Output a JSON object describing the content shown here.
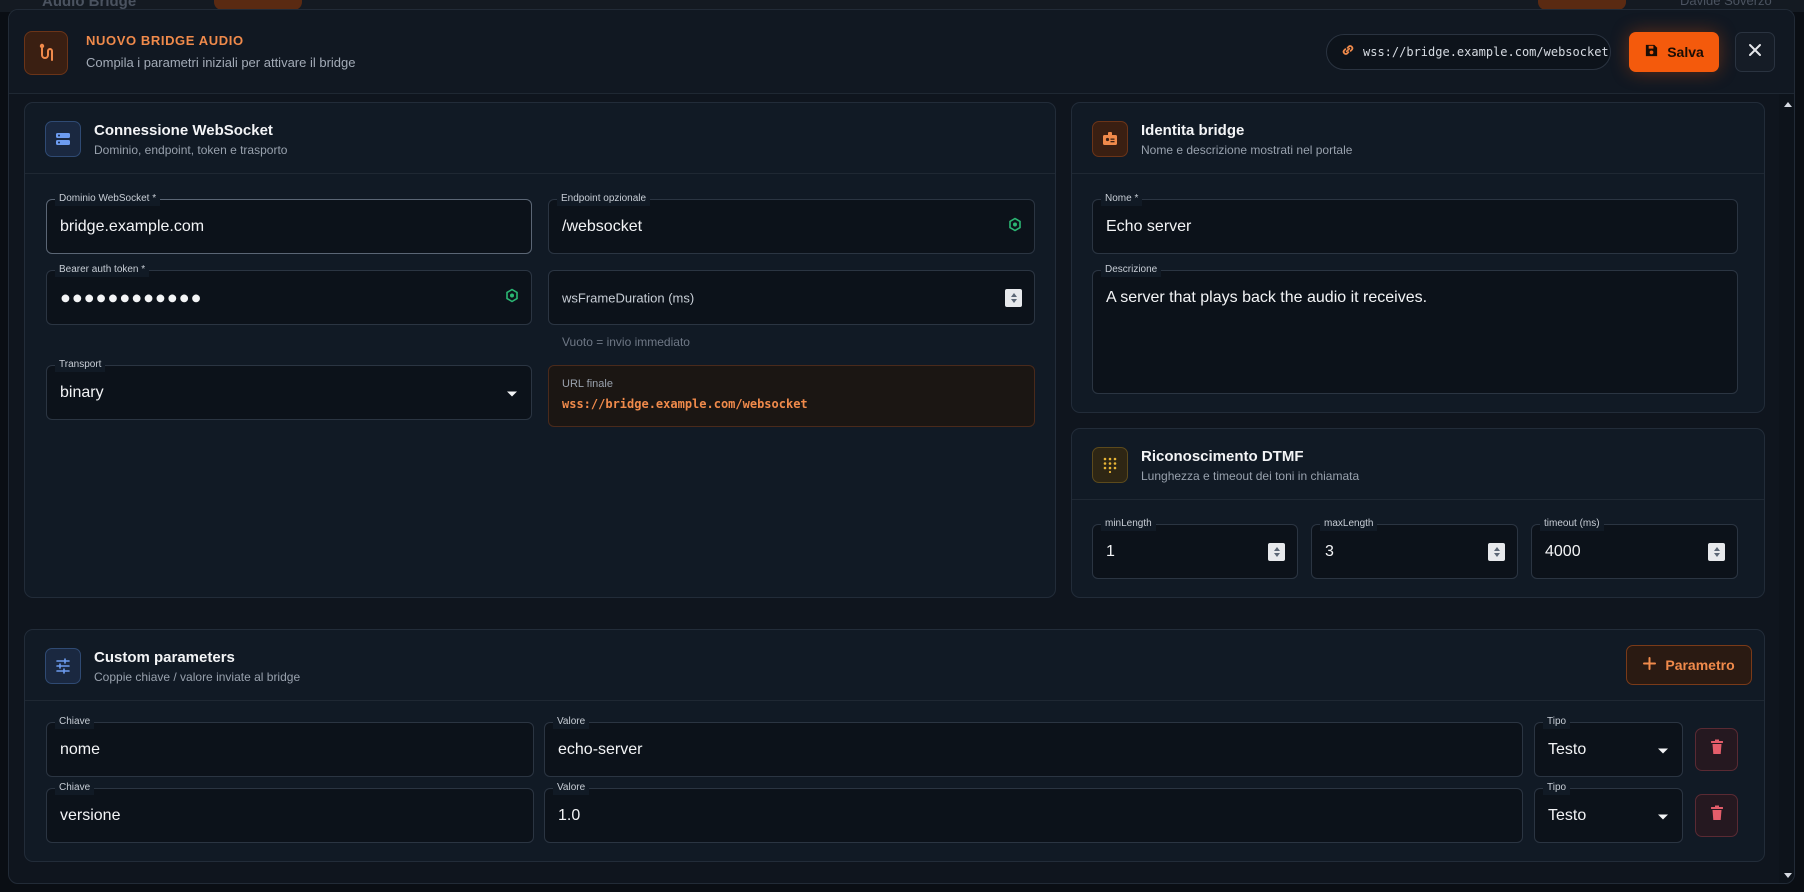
{
  "background": {
    "app_title": "Audio Bridge",
    "user_name": "Davide Soverzo"
  },
  "header": {
    "title": "NUOVO BRIDGE AUDIO",
    "subtitle": "Compila i parametri iniziali per attivare il bridge",
    "url_preview": "wss://bridge.example.com/websocket",
    "save_label": "Salva"
  },
  "websocket": {
    "title": "Connessione WebSocket",
    "subtitle": "Dominio, endpoint, token e trasporto",
    "domain": {
      "label": "Dominio WebSocket *",
      "value": "bridge.example.com"
    },
    "endpoint": {
      "label": "Endpoint opzionale",
      "value": "/websocket"
    },
    "token": {
      "label": "Bearer auth token *",
      "value": "●●●●●●●●●●●●"
    },
    "frame_duration": {
      "placeholder": "wsFrameDuration (ms)",
      "hint": "Vuoto = invio immediato"
    },
    "transport": {
      "label": "Transport",
      "value": "binary"
    },
    "final_url": {
      "label": "URL finale",
      "value": "wss://bridge.example.com/websocket"
    }
  },
  "identity": {
    "title": "Identita bridge",
    "subtitle": "Nome e descrizione mostrati nel portale",
    "name": {
      "label": "Nome *",
      "value": "Echo server"
    },
    "description": {
      "label": "Descrizione",
      "value": "A server that plays back the audio it receives."
    }
  },
  "dtmf": {
    "title": "Riconoscimento DTMF",
    "subtitle": "Lunghezza e timeout dei toni in chiamata",
    "min_length": {
      "label": "minLength",
      "value": "1"
    },
    "max_length": {
      "label": "maxLength",
      "value": "3"
    },
    "timeout": {
      "label": "timeout (ms)",
      "value": "4000"
    }
  },
  "custom": {
    "title": "Custom parameters",
    "subtitle": "Coppie chiave / valore inviate al bridge",
    "add_label": "Parametro",
    "rows": [
      {
        "key_label": "Chiave",
        "key": "nome",
        "value_label": "Valore",
        "value": "echo-server",
        "type_label": "Tipo",
        "type": "Testo"
      },
      {
        "key_label": "Chiave",
        "key": "versione",
        "value_label": "Valore",
        "value": "1.0",
        "type_label": "Tipo",
        "type": "Testo"
      }
    ]
  },
  "colors": {
    "accent": "#f45a0c",
    "accent_text": "#f08a4b",
    "danger": "#e35d6a",
    "success": "#2bb673"
  }
}
